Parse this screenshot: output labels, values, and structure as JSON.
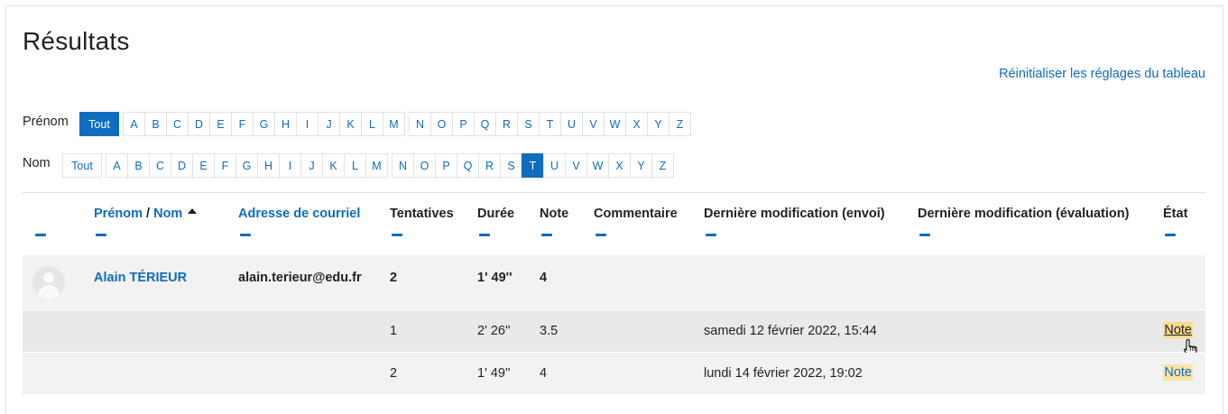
{
  "page": {
    "title": "Résultats",
    "reset_link": "Réinitialiser les réglages du tableau"
  },
  "initials": {
    "firstname_label": "Prénom",
    "lastname_label": "Nom",
    "all_label": "Tout",
    "letters": [
      "A",
      "B",
      "C",
      "D",
      "E",
      "F",
      "G",
      "H",
      "I",
      "J",
      "K",
      "L",
      "M",
      "N",
      "O",
      "P",
      "Q",
      "R",
      "S",
      "T",
      "U",
      "V",
      "W",
      "X",
      "Y",
      "Z"
    ],
    "firstname_selected": "Tout",
    "lastname_selected": "T"
  },
  "table": {
    "headers": {
      "firstname": "Prénom",
      "separator": " / ",
      "lastname": "Nom",
      "email": "Adresse de courriel",
      "attempts": "Tentatives",
      "duration": "Durée",
      "grade": "Note",
      "comment": "Commentaire",
      "last_modified_submission": "Dernière modification (envoi)",
      "last_modified_grading": "Dernière modification (évaluation)",
      "state": "État"
    },
    "user_row": {
      "name": "Alain TÉRIEUR",
      "email": "alain.terieur@edu.fr",
      "attempts": "2",
      "duration": "1' 49''",
      "grade": "4"
    },
    "attempt_rows": [
      {
        "attempt": "1",
        "duration": "2' 26''",
        "grade": "3.5",
        "submitted": "samedi 12 février 2022, 15:44",
        "state": "Note"
      },
      {
        "attempt": "2",
        "duration": "1' 49''",
        "grade": "4",
        "submitted": "lundi 14 février 2022, 19:02",
        "state": "Note"
      }
    ]
  }
}
